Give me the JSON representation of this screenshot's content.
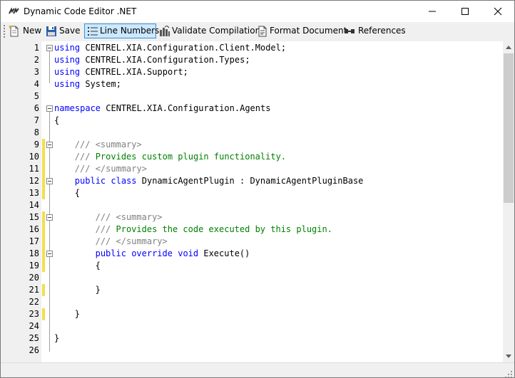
{
  "window": {
    "title": "Dynamic Code Editor .NET"
  },
  "toolbar": {
    "new_label": "New",
    "save_label": "Save",
    "line_numbers_label": "Line Numbers",
    "validate_label": "Validate Compilation",
    "format_label": "Format Document",
    "references_label": "References"
  },
  "editor": {
    "line_numbers_enabled": true,
    "lines": [
      {
        "n": "1",
        "indent": 0,
        "tokens": [
          {
            "t": "kw",
            "v": "using"
          },
          {
            "t": "pl",
            "v": " CENTREL.XIA.Configuration.Client.Model;"
          }
        ]
      },
      {
        "n": "2",
        "indent": 0,
        "tokens": [
          {
            "t": "kw",
            "v": "using"
          },
          {
            "t": "pl",
            "v": " CENTREL.XIA.Configuration.Types;"
          }
        ]
      },
      {
        "n": "3",
        "indent": 0,
        "tokens": [
          {
            "t": "kw",
            "v": "using"
          },
          {
            "t": "pl",
            "v": " CENTREL.XIA.Support;"
          }
        ]
      },
      {
        "n": "4",
        "indent": 0,
        "tokens": [
          {
            "t": "kw",
            "v": "using"
          },
          {
            "t": "pl",
            "v": " System;"
          }
        ]
      },
      {
        "n": "5",
        "indent": 0,
        "tokens": []
      },
      {
        "n": "6",
        "indent": 0,
        "tokens": [
          {
            "t": "kw",
            "v": "namespace"
          },
          {
            "t": "pl",
            "v": " CENTREL.XIA.Configuration.Agents"
          }
        ]
      },
      {
        "n": "7",
        "indent": 0,
        "tokens": [
          {
            "t": "pl",
            "v": "{"
          }
        ]
      },
      {
        "n": "8",
        "indent": 0,
        "tokens": []
      },
      {
        "n": "9",
        "indent": 4,
        "tokens": [
          {
            "t": "xd",
            "v": "/// <summary>"
          }
        ]
      },
      {
        "n": "10",
        "indent": 4,
        "tokens": [
          {
            "t": "xd",
            "v": "///"
          },
          {
            "t": "cm",
            "v": " Provides custom plugin functionality."
          }
        ]
      },
      {
        "n": "11",
        "indent": 4,
        "tokens": [
          {
            "t": "xd",
            "v": "/// </summary>"
          }
        ]
      },
      {
        "n": "12",
        "indent": 4,
        "tokens": [
          {
            "t": "kw",
            "v": "public"
          },
          {
            "t": "pl",
            "v": " "
          },
          {
            "t": "kw",
            "v": "class"
          },
          {
            "t": "pl",
            "v": " DynamicAgentPlugin : DynamicAgentPluginBase"
          }
        ]
      },
      {
        "n": "13",
        "indent": 4,
        "tokens": [
          {
            "t": "pl",
            "v": "{"
          }
        ]
      },
      {
        "n": "14",
        "indent": 0,
        "tokens": []
      },
      {
        "n": "15",
        "indent": 8,
        "tokens": [
          {
            "t": "xd",
            "v": "/// <summary>"
          }
        ]
      },
      {
        "n": "16",
        "indent": 8,
        "tokens": [
          {
            "t": "xd",
            "v": "///"
          },
          {
            "t": "cm",
            "v": " Provides the code executed by this plugin."
          }
        ]
      },
      {
        "n": "17",
        "indent": 8,
        "tokens": [
          {
            "t": "xd",
            "v": "/// </summary>"
          }
        ]
      },
      {
        "n": "18",
        "indent": 8,
        "tokens": [
          {
            "t": "kw",
            "v": "public"
          },
          {
            "t": "pl",
            "v": " "
          },
          {
            "t": "kw",
            "v": "override"
          },
          {
            "t": "pl",
            "v": " "
          },
          {
            "t": "kw",
            "v": "void"
          },
          {
            "t": "pl",
            "v": " Execute()"
          }
        ]
      },
      {
        "n": "19",
        "indent": 8,
        "tokens": [
          {
            "t": "pl",
            "v": "{"
          }
        ]
      },
      {
        "n": "20",
        "indent": 0,
        "tokens": []
      },
      {
        "n": "21",
        "indent": 8,
        "tokens": [
          {
            "t": "pl",
            "v": "}"
          }
        ]
      },
      {
        "n": "22",
        "indent": 0,
        "tokens": []
      },
      {
        "n": "23",
        "indent": 4,
        "tokens": [
          {
            "t": "pl",
            "v": "}"
          }
        ]
      },
      {
        "n": "24",
        "indent": 0,
        "tokens": []
      },
      {
        "n": "25",
        "indent": 0,
        "tokens": [
          {
            "t": "pl",
            "v": "}"
          }
        ]
      },
      {
        "n": "26",
        "indent": 0,
        "tokens": []
      }
    ],
    "changed_lines": [
      "9",
      "10",
      "11",
      "12",
      "13",
      "15",
      "16",
      "17",
      "18",
      "19",
      "21",
      "23"
    ],
    "fold_lines": [
      "1",
      "6",
      "9",
      "12",
      "15",
      "18"
    ]
  },
  "icons": {
    "app": "dynamic-code-app-icon",
    "new": "new-document-icon",
    "save": "floppy-disk-icon",
    "line_numbers": "line-numbers-icon",
    "validate": "validate-compilation-icon",
    "format": "format-document-icon",
    "references": "references-icon"
  },
  "colors": {
    "keyword": "#0000ff",
    "comment": "#008000",
    "xmldoc": "#808080",
    "changed_marker": "#f0e050",
    "checked_button": "#cce8ff"
  }
}
